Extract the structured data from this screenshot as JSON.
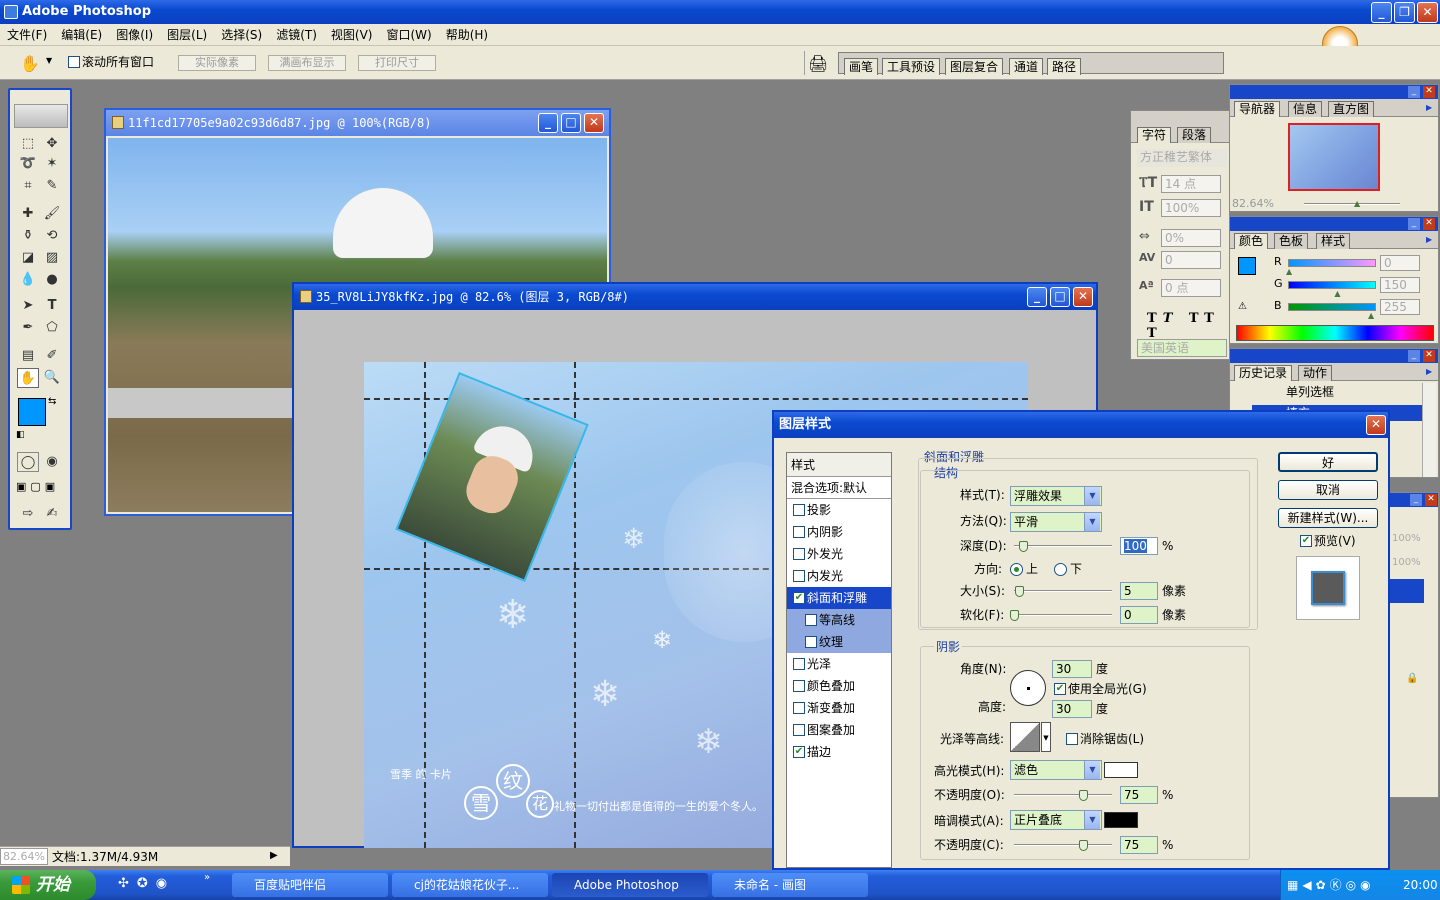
{
  "app": {
    "title": "Adobe Photoshop"
  },
  "menu": [
    "文件(F)",
    "编辑(E)",
    "图像(I)",
    "图层(L)",
    "选择(S)",
    "滤镜(T)",
    "视图(V)",
    "窗口(W)",
    "帮助(H)"
  ],
  "options": {
    "scroll_all": "滚动所有窗口",
    "actual_pixels": "实际像素",
    "fit_screen": "满画布显示",
    "print_size": "打印尺寸"
  },
  "palette_well": [
    "画笔",
    "工具预设",
    "图层复合",
    "通道",
    "路径"
  ],
  "doc1": {
    "title": "11f1cd17705e9a02c93d6d87.jpg @ 100%(RGB/8)"
  },
  "doc2": {
    "title": "35_RV8LiJY8kfKz.jpg @ 82.6% (图层 3, RGB/8#)"
  },
  "canvas_text": {
    "line1": "雪季 的 卡片",
    "circle1": "雪",
    "circle2": "花",
    "circle3": "纹",
    "line2": "礼物一切付出都是值得的一生的爱个冬人。"
  },
  "char_panel": {
    "tabs": [
      "字符",
      "段落"
    ],
    "font": "方正稚艺繁体",
    "size": "14 点",
    "leading": "100%",
    "tracking": "0%",
    "kerning": "0",
    "baseline": "0 点",
    "lang": "美国英语"
  },
  "nav_panel": {
    "tabs": [
      "导航器",
      "信息",
      "直方图"
    ],
    "zoom": "82.64%"
  },
  "color_panel": {
    "tabs": [
      "颜色",
      "色板",
      "样式"
    ],
    "r_label": "R",
    "g_label": "G",
    "b_label": "B",
    "r": "0",
    "g": "150",
    "b": "255",
    "r_pos": 0,
    "g_pos": 0.59,
    "b_pos": 1.0,
    "fg_color": "#0096ff"
  },
  "history_panel": {
    "tabs": [
      "历史记录",
      "动作"
    ],
    "items": [
      "单列选框",
      "填充"
    ]
  },
  "layers_panel": {
    "opacity1": "100%",
    "opacity2": "100%"
  },
  "dialog": {
    "title": "图层样式",
    "styles_header": "样式",
    "blend_default": "混合选项:默认",
    "style_items": [
      {
        "label": "投影",
        "checked": false
      },
      {
        "label": "内阴影",
        "checked": false
      },
      {
        "label": "外发光",
        "checked": false
      },
      {
        "label": "内发光",
        "checked": false
      },
      {
        "label": "斜面和浮雕",
        "checked": true
      },
      {
        "label": "等高线",
        "checked": false
      },
      {
        "label": "纹理",
        "checked": false
      },
      {
        "label": "光泽",
        "checked": false
      },
      {
        "label": "颜色叠加",
        "checked": false
      },
      {
        "label": "渐变叠加",
        "checked": false
      },
      {
        "label": "图案叠加",
        "checked": false
      },
      {
        "label": "描边",
        "checked": true
      }
    ],
    "section": "斜面和浮雕",
    "structure": "结构",
    "style_label": "样式(T):",
    "style_value": "浮雕效果",
    "method_label": "方法(Q):",
    "method_value": "平滑",
    "depth_label": "深度(D):",
    "depth_value": "100",
    "depth_unit": "%",
    "depth_pos": 0.1,
    "direction_label": "方向:",
    "dir_up": "上",
    "dir_down": "下",
    "size_label": "大小(S):",
    "size_value": "5",
    "size_unit": "像素",
    "size_pos": 0.05,
    "soften_label": "软化(F):",
    "soften_value": "0",
    "soften_unit": "像素",
    "soften_pos": 0,
    "shading": "阴影",
    "angle_label": "角度(N):",
    "angle_value": "30",
    "angle_unit": "度",
    "global_light": "使用全局光(G)",
    "altitude_label": "高度:",
    "altitude_value": "30",
    "altitude_unit": "度",
    "gloss_label": "光泽等高线:",
    "antialias": "消除锯齿(L)",
    "highlight_label": "高光模式(H):",
    "highlight_value": "滤色",
    "highlight_color": "#ffffff",
    "hl_opacity_label": "不透明度(O):",
    "hl_opacity_value": "75",
    "hl_opacity_unit": "%",
    "hl_opacity_pos": 0.75,
    "shadow_label": "暗调模式(A):",
    "shadow_value": "正片叠底",
    "shadow_color": "#000000",
    "sh_opacity_label": "不透明度(C):",
    "sh_opacity_value": "75",
    "sh_opacity_unit": "%",
    "sh_opacity_pos": 0.75,
    "ok": "好",
    "cancel": "取消",
    "new_style": "新建样式(W)...",
    "preview": "预览(V)"
  },
  "status": {
    "zoom": "82.64%",
    "doc": "文档:1.37M/4.93M"
  },
  "taskbar": {
    "start": "开始",
    "tasks": [
      "百度贴吧伴侣",
      "cj的花姑娘花伙子...",
      "Adobe Photoshop",
      "未命名 - 画图"
    ],
    "clock": "20:00"
  }
}
